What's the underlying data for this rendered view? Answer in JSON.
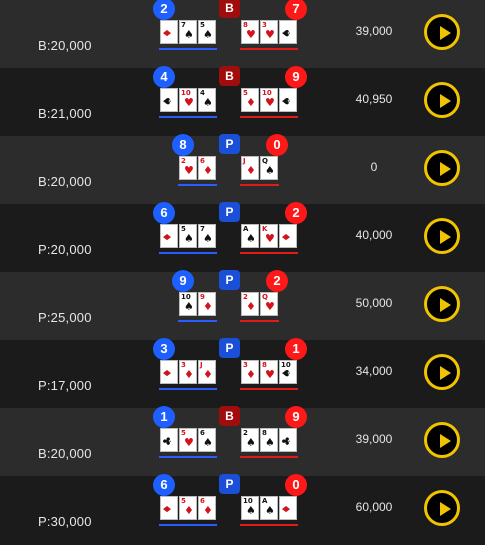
{
  "colors": {
    "player": "#1e5fff",
    "banker": "#ff1818",
    "play_button": "#f0c400"
  },
  "rows": [
    {
      "bet": "B:20,000",
      "amount": "39,000",
      "winner": "B",
      "player_score": "2",
      "banker_score": "7",
      "player_cards": [
        {
          "rank": "",
          "suit": "♦",
          "color": "red",
          "side": true
        },
        {
          "rank": "7",
          "suit": "♠",
          "color": "black"
        },
        {
          "rank": "5",
          "suit": "♠",
          "color": "black"
        }
      ],
      "banker_cards": [
        {
          "rank": "8",
          "suit": "♥",
          "color": "red"
        },
        {
          "rank": "3",
          "suit": "♥",
          "color": "red"
        },
        {
          "rank": "",
          "suit": "♠",
          "color": "black",
          "side": true
        }
      ]
    },
    {
      "bet": "B:21,000",
      "amount": "40,950",
      "winner": "B",
      "player_score": "4",
      "banker_score": "9",
      "player_cards": [
        {
          "rank": "",
          "suit": "♠",
          "color": "black",
          "side": true
        },
        {
          "rank": "10",
          "suit": "♥",
          "color": "red"
        },
        {
          "rank": "4",
          "suit": "♠",
          "color": "black"
        }
      ],
      "banker_cards": [
        {
          "rank": "5",
          "suit": "♦",
          "color": "red"
        },
        {
          "rank": "10",
          "suit": "♥",
          "color": "red"
        },
        {
          "rank": "",
          "suit": "♠",
          "color": "black",
          "side": true
        }
      ]
    },
    {
      "bet": "B:20,000",
      "amount": "0",
      "winner": "P",
      "player_score": "8",
      "banker_score": "0",
      "player_cards": [
        {
          "rank": "2",
          "suit": "♥",
          "color": "red"
        },
        {
          "rank": "6",
          "suit": "♦",
          "color": "red"
        }
      ],
      "banker_cards": [
        {
          "rank": "J",
          "suit": "♦",
          "color": "red"
        },
        {
          "rank": "Q",
          "suit": "♠",
          "color": "black"
        }
      ]
    },
    {
      "bet": "P:20,000",
      "amount": "40,000",
      "winner": "P",
      "player_score": "6",
      "banker_score": "2",
      "player_cards": [
        {
          "rank": "",
          "suit": "♦",
          "color": "red",
          "side": true
        },
        {
          "rank": "5",
          "suit": "♠",
          "color": "black"
        },
        {
          "rank": "7",
          "suit": "♠",
          "color": "black"
        }
      ],
      "banker_cards": [
        {
          "rank": "A",
          "suit": "♠",
          "color": "black"
        },
        {
          "rank": "K",
          "suit": "♥",
          "color": "red"
        },
        {
          "rank": "",
          "suit": "♦",
          "color": "red",
          "side": true
        }
      ]
    },
    {
      "bet": "P:25,000",
      "amount": "50,000",
      "winner": "P",
      "player_score": "9",
      "banker_score": "2",
      "player_cards": [
        {
          "rank": "10",
          "suit": "♠",
          "color": "black"
        },
        {
          "rank": "9",
          "suit": "♦",
          "color": "red"
        }
      ],
      "banker_cards": [
        {
          "rank": "2",
          "suit": "♦",
          "color": "red"
        },
        {
          "rank": "Q",
          "suit": "♥",
          "color": "red"
        }
      ]
    },
    {
      "bet": "P:17,000",
      "amount": "34,000",
      "winner": "P",
      "player_score": "3",
      "banker_score": "1",
      "player_cards": [
        {
          "rank": "",
          "suit": "♦",
          "color": "red",
          "side": true
        },
        {
          "rank": "3",
          "suit": "♦",
          "color": "red"
        },
        {
          "rank": "J",
          "suit": "♦",
          "color": "red"
        }
      ],
      "banker_cards": [
        {
          "rank": "3",
          "suit": "♦",
          "color": "red"
        },
        {
          "rank": "8",
          "suit": "♥",
          "color": "red"
        },
        {
          "rank": "10",
          "suit": "♠",
          "color": "black",
          "side": true
        }
      ]
    },
    {
      "bet": "B:20,000",
      "amount": "39,000",
      "winner": "B",
      "player_score": "1",
      "banker_score": "9",
      "player_cards": [
        {
          "rank": "",
          "suit": "♣",
          "color": "black",
          "side": true
        },
        {
          "rank": "5",
          "suit": "♥",
          "color": "red"
        },
        {
          "rank": "6",
          "suit": "♠",
          "color": "black"
        }
      ],
      "banker_cards": [
        {
          "rank": "2",
          "suit": "♠",
          "color": "black"
        },
        {
          "rank": "8",
          "suit": "♠",
          "color": "black"
        },
        {
          "rank": "",
          "suit": "♣",
          "color": "black",
          "side": true
        }
      ]
    },
    {
      "bet": "P:30,000",
      "amount": "60,000",
      "winner": "P",
      "player_score": "6",
      "banker_score": "0",
      "player_cards": [
        {
          "rank": "",
          "suit": "♦",
          "color": "red",
          "side": true
        },
        {
          "rank": "5",
          "suit": "♦",
          "color": "red"
        },
        {
          "rank": "6",
          "suit": "♦",
          "color": "red"
        }
      ],
      "banker_cards": [
        {
          "rank": "10",
          "suit": "♠",
          "color": "black"
        },
        {
          "rank": "A",
          "suit": "♠",
          "color": "black"
        },
        {
          "rank": "",
          "suit": "♦",
          "color": "red",
          "side": true
        }
      ]
    }
  ]
}
